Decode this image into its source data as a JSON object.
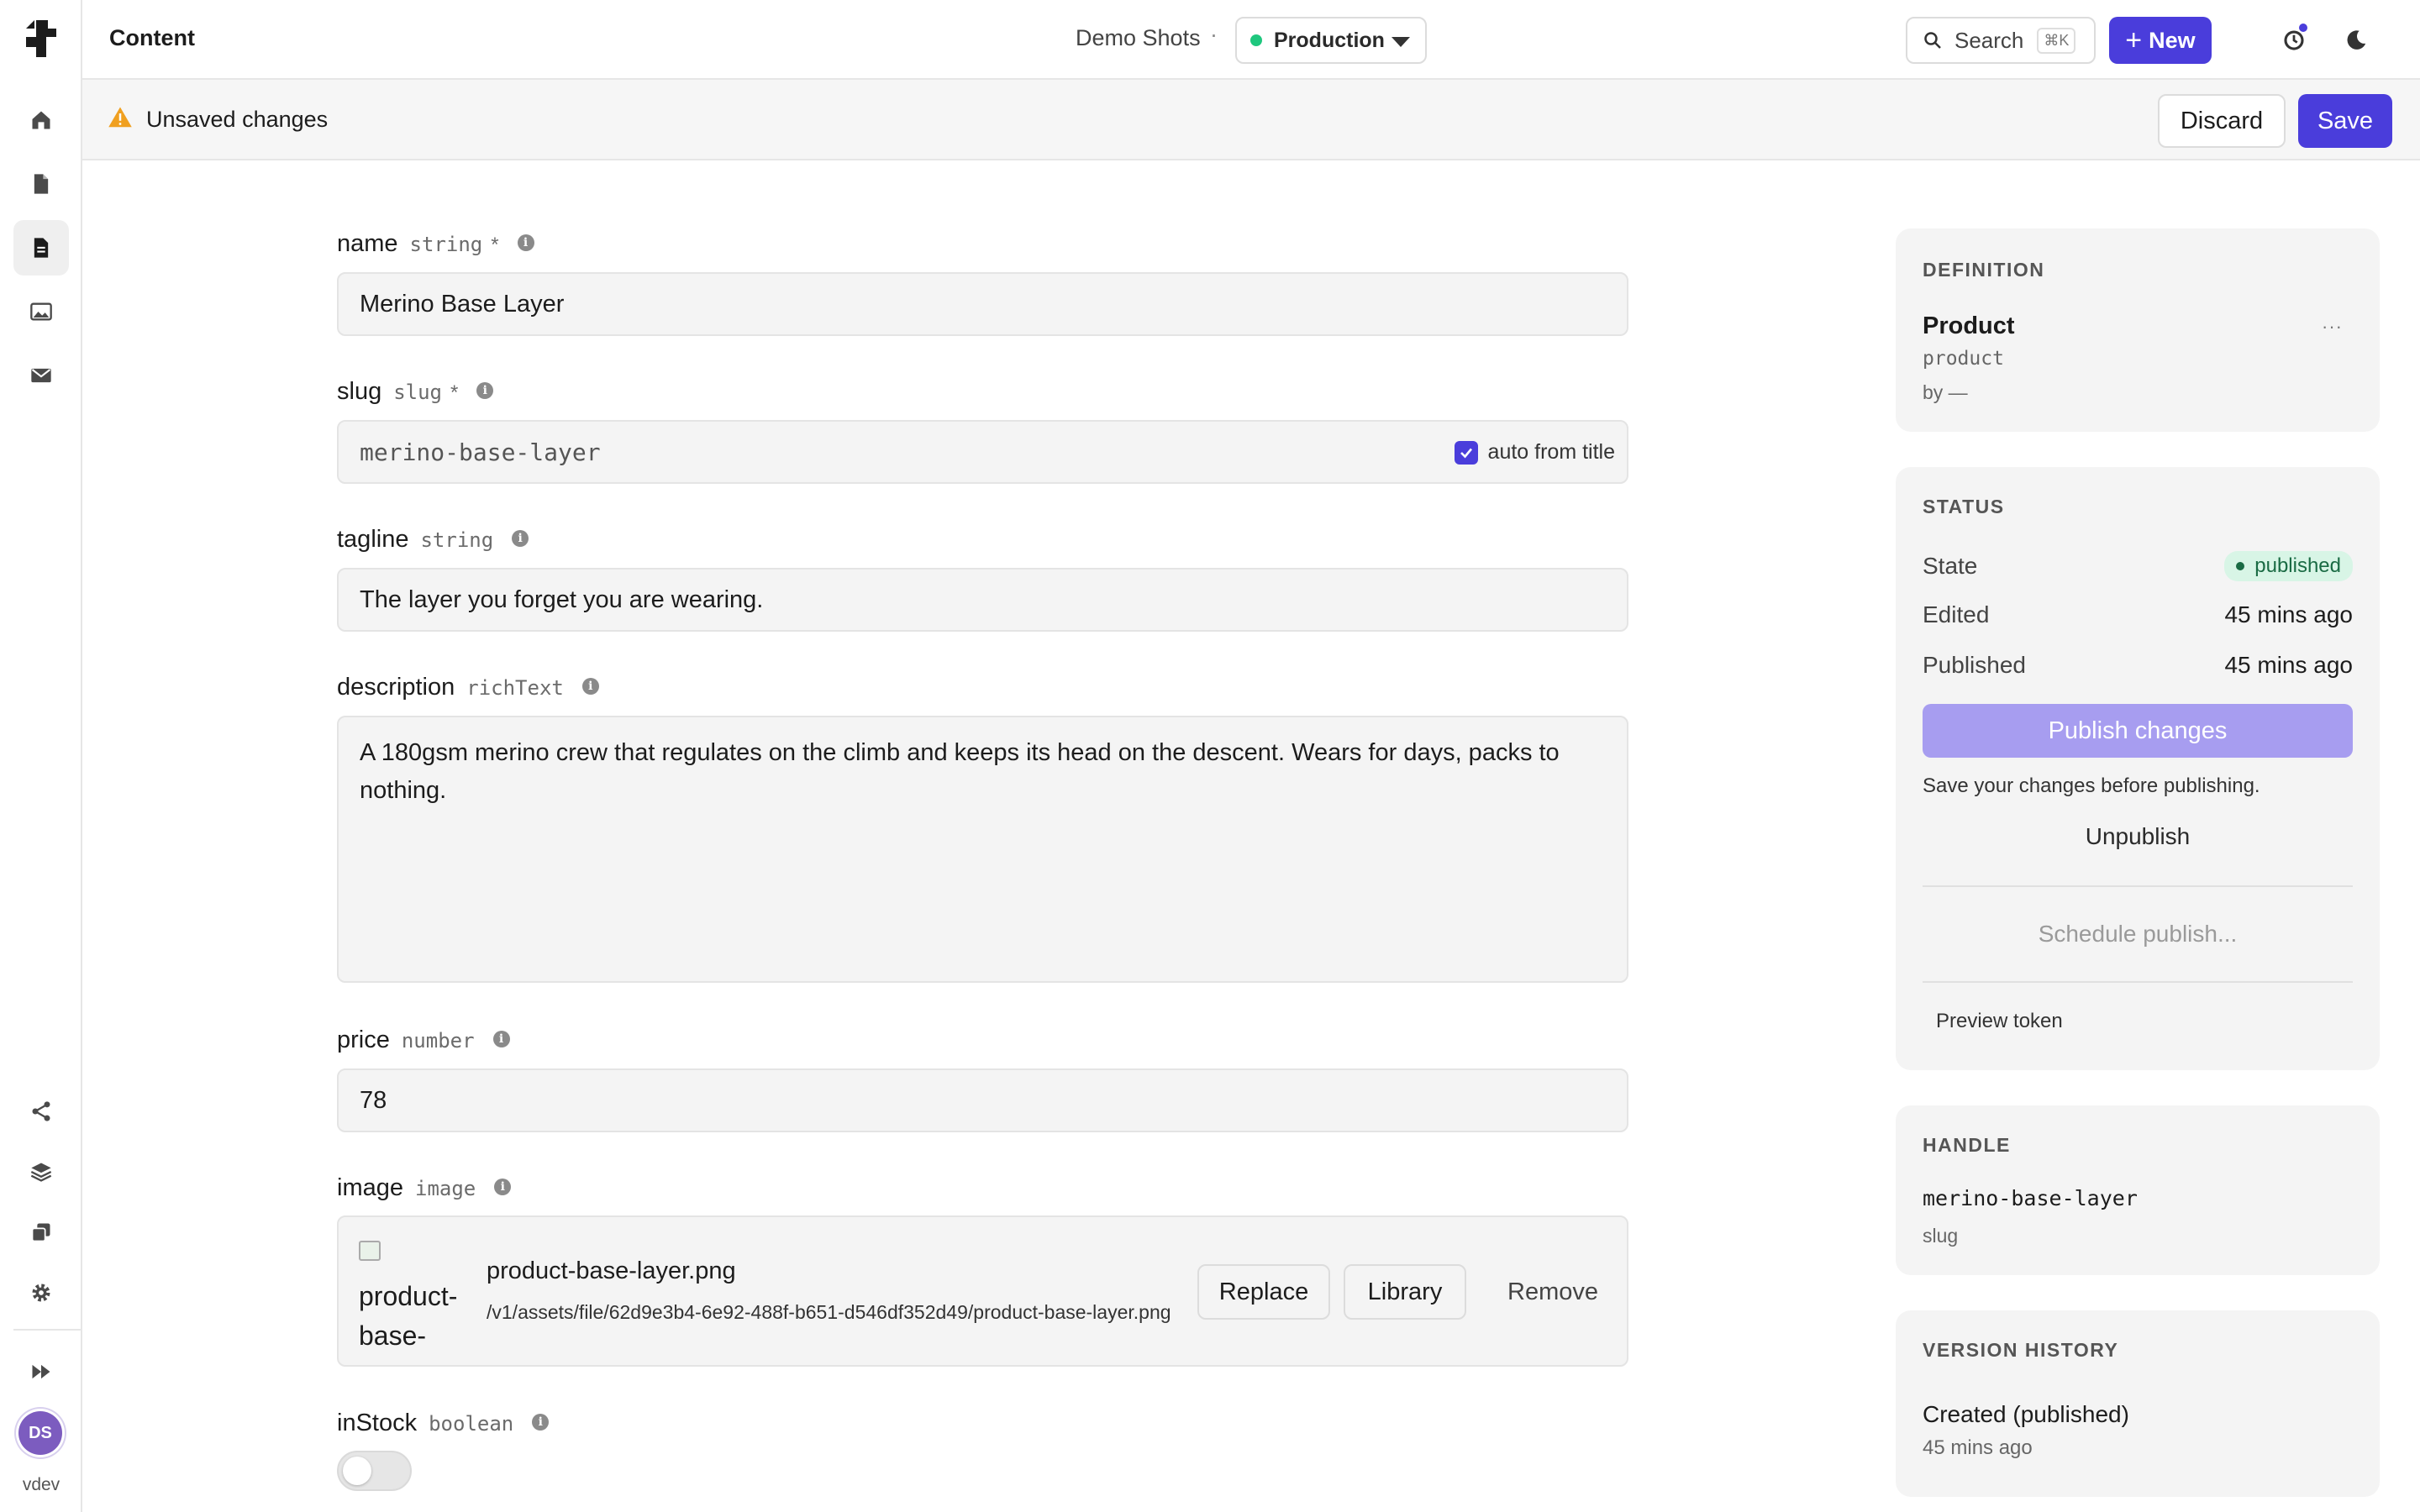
{
  "sidebar": {
    "user_initials": "DS",
    "user_label": "vdev"
  },
  "topbar": {
    "title": "Content",
    "project": "Demo Shots",
    "separator": "·",
    "environment": "Production",
    "search_label": "Search",
    "search_shortcut": "⌘K",
    "new_label": "New",
    "help_label": "?"
  },
  "unsaved_bar": {
    "message": "Unsaved changes",
    "discard_label": "Discard",
    "save_label": "Save"
  },
  "fields": {
    "name": {
      "label": "name",
      "type": "string",
      "required": "*",
      "value": "Merino Base Layer"
    },
    "slug": {
      "label": "slug",
      "type": "slug",
      "required": "*",
      "value": "merino-base-layer",
      "auto_label": "auto from title",
      "auto_checked": true
    },
    "tagline": {
      "label": "tagline",
      "type": "string",
      "value": "The layer you forget you are wearing."
    },
    "description": {
      "label": "description",
      "type": "richText",
      "value": "A 180gsm merino crew that regulates on the climb and keeps its head on the descent. Wears for days, packs to nothing."
    },
    "price": {
      "label": "price",
      "type": "number",
      "value": "78"
    },
    "image": {
      "label": "image",
      "type": "image",
      "alt_text": "product-base-",
      "file_name": "product-base-layer.png",
      "file_path": "/v1/assets/file/62d9e3b4-6e92-488f-b651-d546df352d49/product-base-layer.png",
      "replace_label": "Replace",
      "library_label": "Library",
      "remove_label": "Remove"
    },
    "inStock": {
      "label": "inStock",
      "type": "boolean",
      "value": false
    }
  },
  "definition": {
    "heading": "DEFINITION",
    "name": "Product",
    "api_id": "product",
    "by": "by —",
    "more": "···"
  },
  "status": {
    "heading": "STATUS",
    "state_label": "State",
    "state_value": "published",
    "edited_label": "Edited",
    "edited_value": "45 mins ago",
    "published_label": "Published",
    "published_value": "45 mins ago",
    "publish_changes_label": "Publish changes",
    "hint": "Save your changes before publishing.",
    "unpublish_label": "Unpublish",
    "schedule_label": "Schedule publish...",
    "preview_token_label": "Preview token"
  },
  "handle": {
    "heading": "HANDLE",
    "value": "merino-base-layer",
    "kind": "slug"
  },
  "version_history": {
    "heading": "VERSION HISTORY",
    "items": [
      {
        "title": "Created (published)",
        "time": "45 mins ago"
      }
    ]
  },
  "colors": {
    "accent": "#4a3ddb",
    "accent_disabled": "#a79df0",
    "env_dot": "#1fc77e",
    "warning": "#f0a020",
    "published_badge_bg": "#d8f5e6",
    "published_badge_fg": "#1a6b44"
  }
}
